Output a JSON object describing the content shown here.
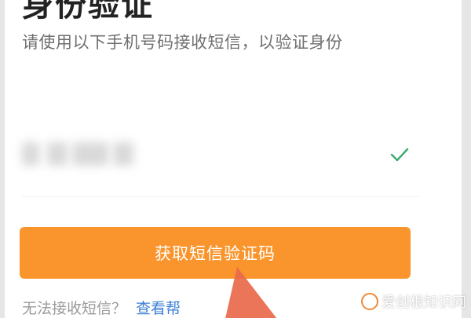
{
  "page": {
    "title": "身份验证",
    "subtitle": "请使用以下手机号码接收短信，以验证身份"
  },
  "phone": {
    "status_icon": "check-icon",
    "status_color": "#3aaa6e"
  },
  "actions": {
    "get_code_label": "获取短信验证码",
    "primary_color": "#f9952c"
  },
  "footer": {
    "help_text": "无法接收短信？",
    "help_link": "查看帮"
  },
  "overlay": {
    "arrow_color": "#e8694a"
  },
  "watermark": {
    "text": "爱创根知识网"
  }
}
